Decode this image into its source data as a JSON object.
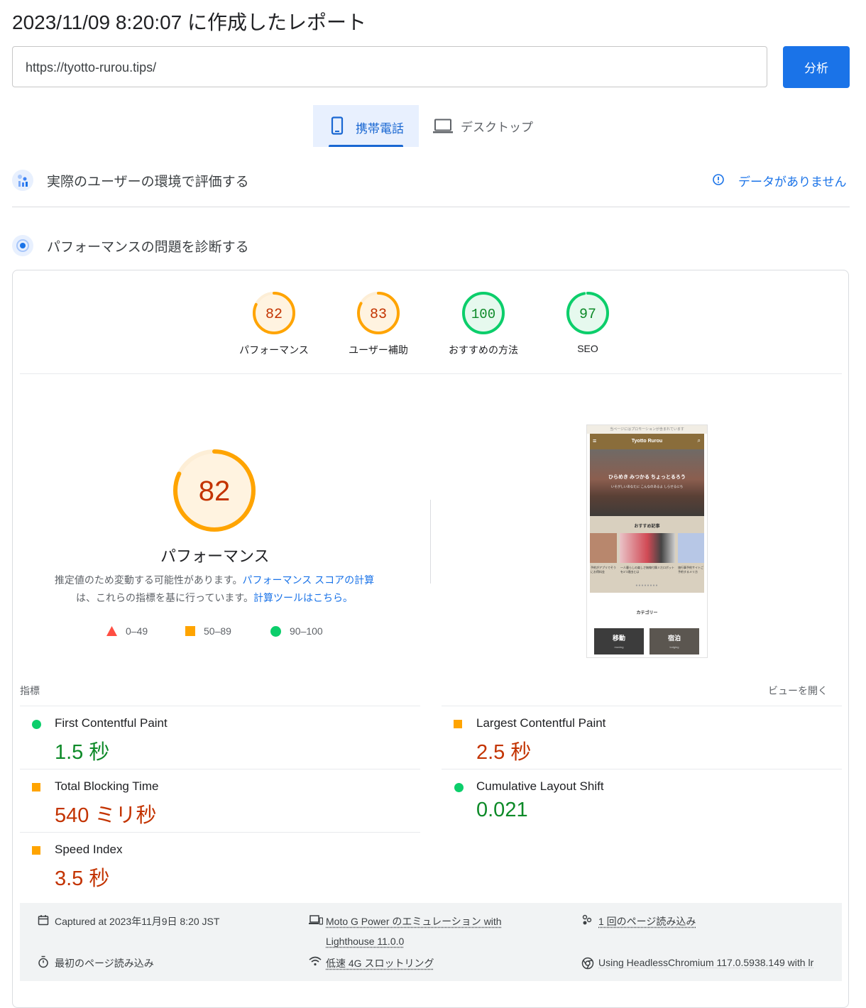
{
  "header": {
    "title": "2023/11/09 8:20:07 に作成したレポート",
    "url_value": "https://tyotto-rurou.tips/",
    "analyze_label": "分析"
  },
  "device_tabs": [
    {
      "label": "携帯電話",
      "selected": true
    },
    {
      "label": "デスクトップ",
      "selected": false
    }
  ],
  "field_data": {
    "heading": "実際のユーザーの環境で評価する",
    "status": "データがありません"
  },
  "diagnose": {
    "heading": "パフォーマンスの問題を診断する"
  },
  "scores": [
    {
      "value": "82",
      "label": "パフォーマンス",
      "rating": "average"
    },
    {
      "value": "83",
      "label": "ユーザー補助",
      "rating": "average"
    },
    {
      "value": "100",
      "label": "おすすめの方法",
      "rating": "good"
    },
    {
      "value": "97",
      "label": "SEO",
      "rating": "good"
    }
  ],
  "main_score": {
    "value": "82",
    "label": "パフォーマンス",
    "desc_part1": "推定値のため変動する可能性があります。",
    "desc_link1": "パフォーマンス スコアの計算",
    "desc_part2": "は、これらの指標を基に行っています。",
    "desc_link2": "計算ツールはこちら。"
  },
  "legend": [
    {
      "range": "0–49",
      "color": "#ff4e42"
    },
    {
      "range": "50–89",
      "color": "#ffa400"
    },
    {
      "range": "90–100",
      "color": "#0cce6b"
    }
  ],
  "thumbnail": {
    "banner": "当ページにはプロモーションが含まれています",
    "site_name": "Tyotto Rurou",
    "hero_title": "ひらめき みつかる ちょっとるろう",
    "hero_sub": "いそがしいあなたに こんなのあるよ しらせるにち",
    "section_title": "おすすめ記事",
    "articles": [
      "予約がアプリでそうにお得料金",
      "一人暮らしの楽しさ無線付属ミだロボットを3つ理由とは",
      "旅行事予約サイトご予約するメリ方"
    ],
    "category_title": "カテゴリー",
    "categories": [
      {
        "name": "移動",
        "sub": "moving"
      },
      {
        "name": "宿泊",
        "sub": "lodging"
      }
    ]
  },
  "metrics": {
    "heading": "指標",
    "expand_label": "ビューを開く",
    "items": [
      {
        "name": "First Contentful Paint",
        "value": "1.5 秒",
        "rating": "good"
      },
      {
        "name": "Largest Contentful Paint",
        "value": "2.5 秒",
        "rating": "average"
      },
      {
        "name": "Total Blocking Time",
        "value": "540 ミリ秒",
        "rating": "average"
      },
      {
        "name": "Cumulative Layout Shift",
        "value": "0.021",
        "rating": "good"
      },
      {
        "name": "Speed Index",
        "value": "3.5 秒",
        "rating": "average"
      }
    ]
  },
  "run_info": {
    "captured": "Captured at 2023年11月9日 8:20 JST",
    "first_load": "最初のページ読み込み",
    "device_line1": "Moto G Power のエミュレーション with",
    "device_line2": "Lighthouse 11.0.0",
    "throttling": "低速 4G スロットリング",
    "page_loads": "1 回のページ読み込み",
    "browser": "Using HeadlessChromium 117.0.5938.149 with lr"
  },
  "colors": {
    "accent": "#1a73e8",
    "average": "#ffa400",
    "average_text": "#c33300",
    "good": "#0cce6b",
    "good_text": "#0d8a28",
    "poor": "#ff4e42"
  }
}
